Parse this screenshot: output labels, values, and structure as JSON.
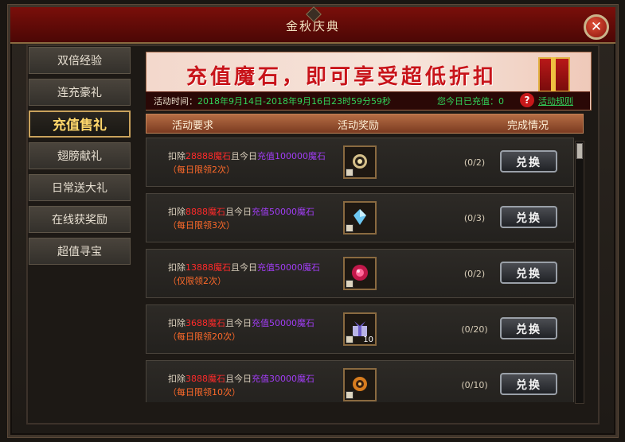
{
  "title": "金秋庆典",
  "close_label": "✕",
  "sidebar": {
    "items": [
      {
        "label": "双倍经验"
      },
      {
        "label": "连充豪礼"
      },
      {
        "label": "充值售礼"
      },
      {
        "label": "翅膀献礼"
      },
      {
        "label": "日常送大礼"
      },
      {
        "label": "在线获奖励"
      },
      {
        "label": "超值寻宝"
      }
    ]
  },
  "banner": {
    "text": "充值魔石，即可享受超低折扣"
  },
  "info": {
    "time_label": "活动时间：",
    "time_value": "2018年9月14日-2018年9月16日23时59分59秒",
    "recharge_label": "您今日已充值：0",
    "help_label": "?",
    "rules_label": "活动规则"
  },
  "table": {
    "headers": {
      "requirement": "活动要求",
      "reward": "活动奖励",
      "status": "完成情况"
    },
    "rows": [
      {
        "pre": "扣除",
        "cost": "28888魔石",
        "mid": "且今日",
        "charge": "充值100000魔石",
        "limit": "（每日限领2次）",
        "progress": "(0/2)",
        "button": "兑换",
        "qty": "",
        "icon": "ring-icon"
      },
      {
        "pre": "扣除",
        "cost": "8888魔石",
        "mid": "且今日",
        "charge": "充值50000魔石",
        "limit": "（每日限领3次）",
        "progress": "(0/3)",
        "button": "兑换",
        "qty": "",
        "icon": "crystal-icon"
      },
      {
        "pre": "扣除",
        "cost": "13888魔石",
        "mid": "且今日",
        "charge": "充值50000魔石",
        "limit": "（仅限领2次）",
        "progress": "(0/2)",
        "button": "兑换",
        "qty": "",
        "icon": "orb-icon"
      },
      {
        "pre": "扣除",
        "cost": "3688魔石",
        "mid": "且今日",
        "charge": "充值50000魔石",
        "limit": "（每日限领20次）",
        "progress": "(0/20)",
        "button": "兑换",
        "qty": "10",
        "icon": "gift-box-icon"
      },
      {
        "pre": "扣除",
        "cost": "3888魔石",
        "mid": "且今日",
        "charge": "充值30000魔石",
        "limit": "（每日限领10次）",
        "progress": "(0/10)",
        "button": "兑换",
        "qty": "",
        "icon": "amber-ring-icon"
      }
    ]
  }
}
